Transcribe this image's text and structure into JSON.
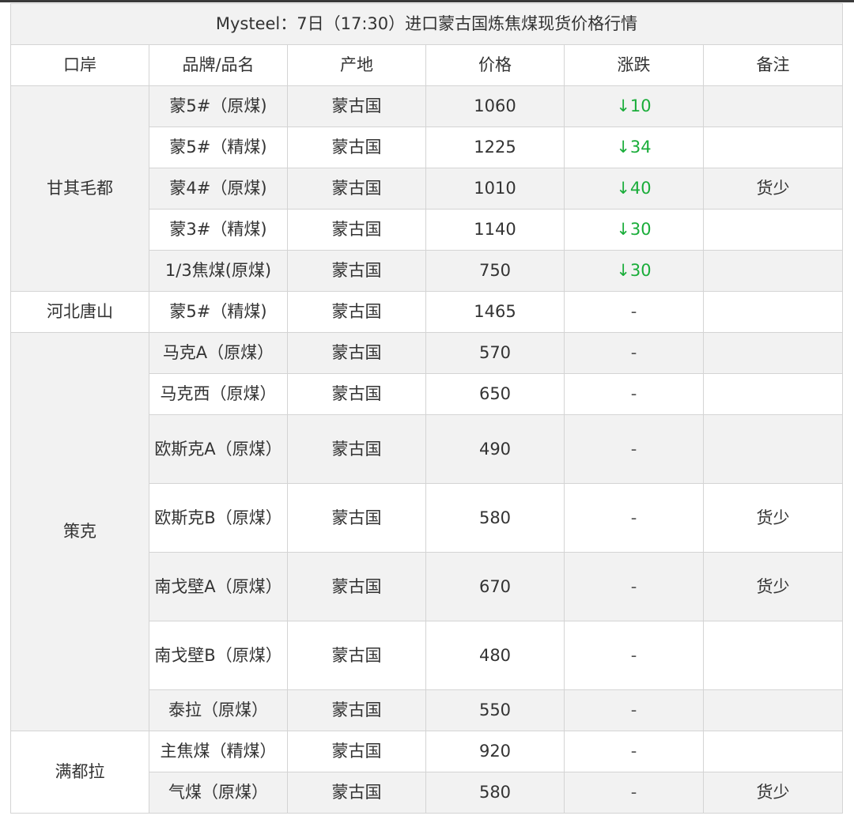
{
  "title": "Mysteel：7日（17:30）进口蒙古国炼焦煤现货价格行情",
  "headers": [
    "口岸",
    "品牌/品名",
    "产地",
    "价格",
    "涨跌",
    "备注"
  ],
  "colors": {
    "down": "#1aad3a",
    "stripe": "#f2f2f2",
    "border": "#d4d4d4"
  },
  "rows": [
    {
      "port": "甘其毛都",
      "brand": "蒙5#（原煤)",
      "origin": "蒙古国",
      "price": "1060",
      "change": "↓10",
      "note": ""
    },
    {
      "port": "",
      "brand": "蒙5#（精煤)",
      "origin": "蒙古国",
      "price": "1225",
      "change": "↓34",
      "note": ""
    },
    {
      "port": "",
      "brand": "蒙4#（原煤)",
      "origin": "蒙古国",
      "price": "1010",
      "change": "↓40",
      "note": "货少"
    },
    {
      "port": "",
      "brand": "蒙3#（精煤)",
      "origin": "蒙古国",
      "price": "1140",
      "change": "↓30",
      "note": ""
    },
    {
      "port": "",
      "brand": "1/3焦煤(原煤)",
      "origin": "蒙古国",
      "price": "750",
      "change": "↓30",
      "note": ""
    },
    {
      "port": "河北唐山",
      "brand": "蒙5#（精煤)",
      "origin": "蒙古国",
      "price": "1465",
      "change": "-",
      "note": ""
    },
    {
      "port": "策克",
      "brand": "马克A（原煤）",
      "origin": "蒙古国",
      "price": "570",
      "change": "-",
      "note": ""
    },
    {
      "port": "",
      "brand": "马克西（原煤）",
      "origin": "蒙古国",
      "price": "650",
      "change": "-",
      "note": ""
    },
    {
      "port": "",
      "brand": "欧斯克A（原煤）",
      "origin": "蒙古国",
      "price": "490",
      "change": "-",
      "note": ""
    },
    {
      "port": "",
      "brand": "欧斯克B（原煤）",
      "origin": "蒙古国",
      "price": "580",
      "change": "-",
      "note": "货少"
    },
    {
      "port": "",
      "brand": "南戈壁A（原煤）",
      "origin": "蒙古国",
      "price": "670",
      "change": "-",
      "note": "货少"
    },
    {
      "port": "",
      "brand": "南戈壁B（原煤）",
      "origin": "蒙古国",
      "price": "480",
      "change": "-",
      "note": ""
    },
    {
      "port": "",
      "brand": "泰拉（原煤）",
      "origin": "蒙古国",
      "price": "550",
      "change": "-",
      "note": ""
    },
    {
      "port": "满都拉",
      "brand": "主焦煤（精煤）",
      "origin": "蒙古国",
      "price": "920",
      "change": "-",
      "note": ""
    },
    {
      "port": "",
      "brand": "气煤（原煤）",
      "origin": "蒙古国",
      "price": "580",
      "change": "-",
      "note": "货少"
    }
  ]
}
